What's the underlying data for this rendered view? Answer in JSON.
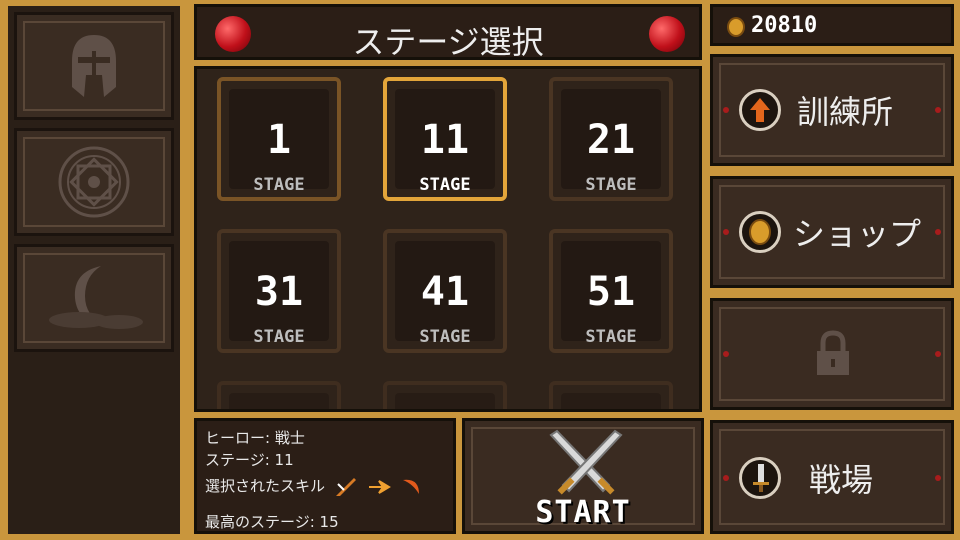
{
  "title": "ステージ選択",
  "gold": "20810",
  "stages": [
    {
      "number": "1",
      "label": "STAGE",
      "state": "half"
    },
    {
      "number": "11",
      "label": "STAGE",
      "state": "selected"
    },
    {
      "number": "21",
      "label": "STAGE",
      "state": "dim"
    },
    {
      "number": "31",
      "label": "STAGE",
      "state": "dim"
    },
    {
      "number": "41",
      "label": "STAGE",
      "state": "dim"
    },
    {
      "number": "51",
      "label": "STAGE",
      "state": "dim"
    }
  ],
  "info": {
    "hero": "ヒーロー: 戦士",
    "stage": "ステージ: 11",
    "skills_label": "選択されたスキル",
    "best_stage": "最高のステージ: 15"
  },
  "start_label": "START",
  "right_menu": {
    "training": "訓練所",
    "shop": "ショップ",
    "arena": "戦場"
  },
  "left_menu_icons": [
    "helmet-icon",
    "magic-circle-icon",
    "moon-cloud-icon"
  ],
  "colors": {
    "accent_gold": "#c9963d",
    "selected_border": "#e3a53a",
    "gem_red": "#c0101a"
  }
}
